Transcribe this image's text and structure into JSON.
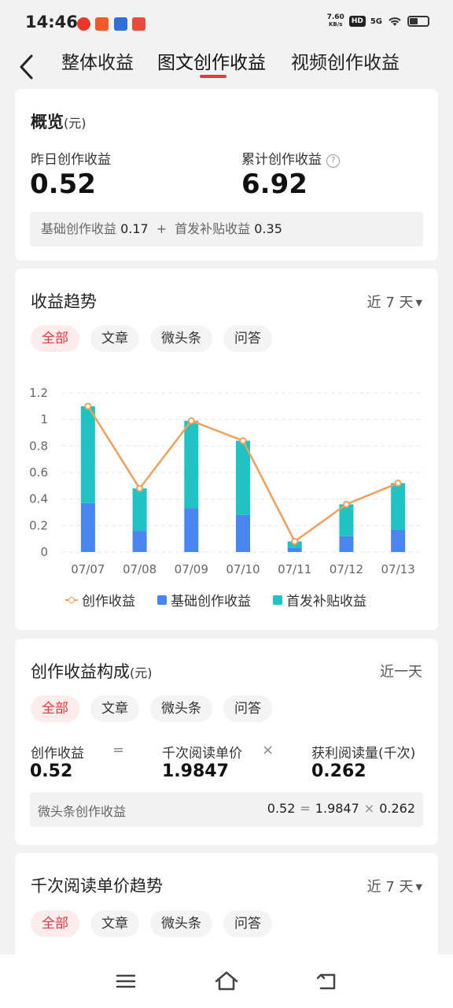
{
  "status": {
    "time": "14:46",
    "net_speed_value": "7.60",
    "net_speed_unit": "KB/s",
    "hd": "HD",
    "signal": "5G",
    "notif_colors": [
      "#e8372c",
      "#f05a28",
      "#2f6fd6",
      "#e94b3c"
    ]
  },
  "header": {
    "tabs": [
      {
        "label": "整体收益"
      },
      {
        "label": "图文创作收益"
      },
      {
        "label": "视频创作收益"
      }
    ],
    "active_tab": 1
  },
  "overview": {
    "title": "概览",
    "unit": "(元)",
    "yesterday_label": "昨日创作收益",
    "yesterday_value": "0.52",
    "total_label": "累计创作收益",
    "total_value": "6.92",
    "base_label": "基础创作收益",
    "base_value": "0.17",
    "plus": "+",
    "subsidy_label": "首发补贴收益",
    "subsidy_value": "0.35"
  },
  "trend": {
    "title": "收益趋势",
    "range": "近 7 天",
    "filters": [
      "全部",
      "文章",
      "微头条",
      "问答"
    ],
    "legend": [
      "创作收益",
      "基础创作收益",
      "首发补贴收益"
    ]
  },
  "chart_data": {
    "type": "bar",
    "categories": [
      "07/07",
      "07/08",
      "07/09",
      "07/10",
      "07/11",
      "07/12",
      "07/13"
    ],
    "series": [
      {
        "name": "基础创作收益",
        "type": "bar",
        "stack": "total",
        "color": "#4a86f0",
        "values": [
          0.37,
          0.16,
          0.33,
          0.28,
          0.03,
          0.12,
          0.17
        ]
      },
      {
        "name": "首发补贴收益",
        "type": "bar",
        "stack": "total",
        "color": "#1fc3c3",
        "values": [
          0.73,
          0.32,
          0.66,
          0.56,
          0.05,
          0.24,
          0.35
        ]
      },
      {
        "name": "创作收益",
        "type": "line",
        "color": "#f0a05a",
        "values": [
          1.1,
          0.48,
          0.99,
          0.84,
          0.08,
          0.36,
          0.52
        ]
      }
    ],
    "ylim": [
      0,
      1.2
    ],
    "yticks": [
      "0",
      "0.2",
      "0.4",
      "0.6",
      "0.8",
      "1",
      "1.2"
    ],
    "grid": true,
    "legend_position": "bottom"
  },
  "composition": {
    "title": "创作收益构成",
    "unit": "(元)",
    "range": "近一天",
    "filters": [
      "全部",
      "文章",
      "微头条",
      "问答"
    ],
    "income_label": "创作收益",
    "income_value": "0.52",
    "eq": "=",
    "rpm_label": "千次阅读单价",
    "rpm_value": "1.9847",
    "times": "×",
    "reads_label": "获利阅读量(千次)",
    "reads_value": "0.262",
    "detail_label": "微头条创作收益",
    "detail_income": "0.52",
    "detail_rpm": "1.9847",
    "detail_reads": "0.262"
  },
  "rpm_trend": {
    "title": "千次阅读单价趋势",
    "range": "近 7 天",
    "filters": [
      "全部",
      "文章",
      "微头条",
      "问答"
    ]
  }
}
